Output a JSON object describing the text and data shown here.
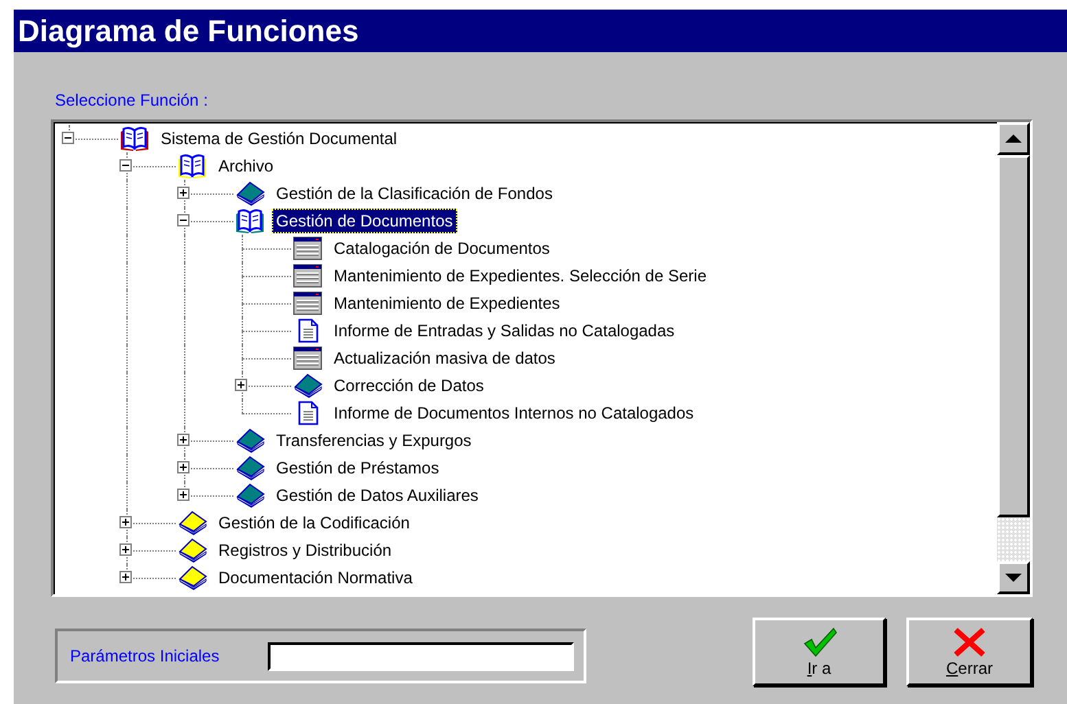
{
  "window": {
    "title": "Diagrama de Funciones"
  },
  "tree_label": "Seleccione Función :",
  "tree": [
    {
      "label": "Sistema de Gestión Documental",
      "kind": "book",
      "color": "#c00000",
      "expanded": true,
      "selected": false,
      "children": [
        {
          "label": "Archivo",
          "kind": "book",
          "color": "#ffff00",
          "expanded": true,
          "selected": false,
          "children": [
            {
              "label": "Gestión de la Clasificación de Fondos",
              "kind": "book",
              "color": "#008080",
              "expanded": false,
              "selected": false
            },
            {
              "label": "Gestión de Documentos",
              "kind": "book",
              "color": "#008080",
              "expanded": true,
              "selected": true,
              "children": [
                {
                  "label": "Catalogación de Documentos",
                  "kind": "form",
                  "selected": false
                },
                {
                  "label": "Mantenimiento de Expedientes. Selección de Serie",
                  "kind": "form",
                  "selected": false
                },
                {
                  "label": "Mantenimiento de Expedientes",
                  "kind": "form",
                  "selected": false
                },
                {
                  "label": "Informe de Entradas y Salidas no Catalogadas",
                  "kind": "report",
                  "selected": false
                },
                {
                  "label": "Actualización masiva de datos",
                  "kind": "form",
                  "selected": false
                },
                {
                  "label": "Corrección de Datos",
                  "kind": "book",
                  "color": "#008080",
                  "expanded": false,
                  "selected": false
                },
                {
                  "label": "Informe de Documentos Internos no Catalogados",
                  "kind": "report",
                  "selected": false
                }
              ]
            },
            {
              "label": "Transferencias y Expurgos",
              "kind": "book",
              "color": "#008080",
              "expanded": false,
              "selected": false
            },
            {
              "label": "Gestión de Préstamos",
              "kind": "book",
              "color": "#008080",
              "expanded": false,
              "selected": false
            },
            {
              "label": "Gestión de Datos Auxiliares",
              "kind": "book",
              "color": "#008080",
              "expanded": false,
              "selected": false
            }
          ]
        },
        {
          "label": "Gestión de la Codificación",
          "kind": "book",
          "color": "#ffff00",
          "expanded": false,
          "selected": false
        },
        {
          "label": "Registros y Distribución",
          "kind": "book",
          "color": "#ffff00",
          "expanded": false,
          "selected": false
        },
        {
          "label": "Documentación Normativa",
          "kind": "book",
          "color": "#ffff00",
          "expanded": false,
          "selected": false
        }
      ]
    }
  ],
  "parameters": {
    "label": "Parámetros Iniciales"
  },
  "buttons": [
    {
      "kind": "ok",
      "key": "I",
      "rest": "r a"
    },
    {
      "kind": "cancel",
      "key": "C",
      "rest": "errar"
    }
  ]
}
